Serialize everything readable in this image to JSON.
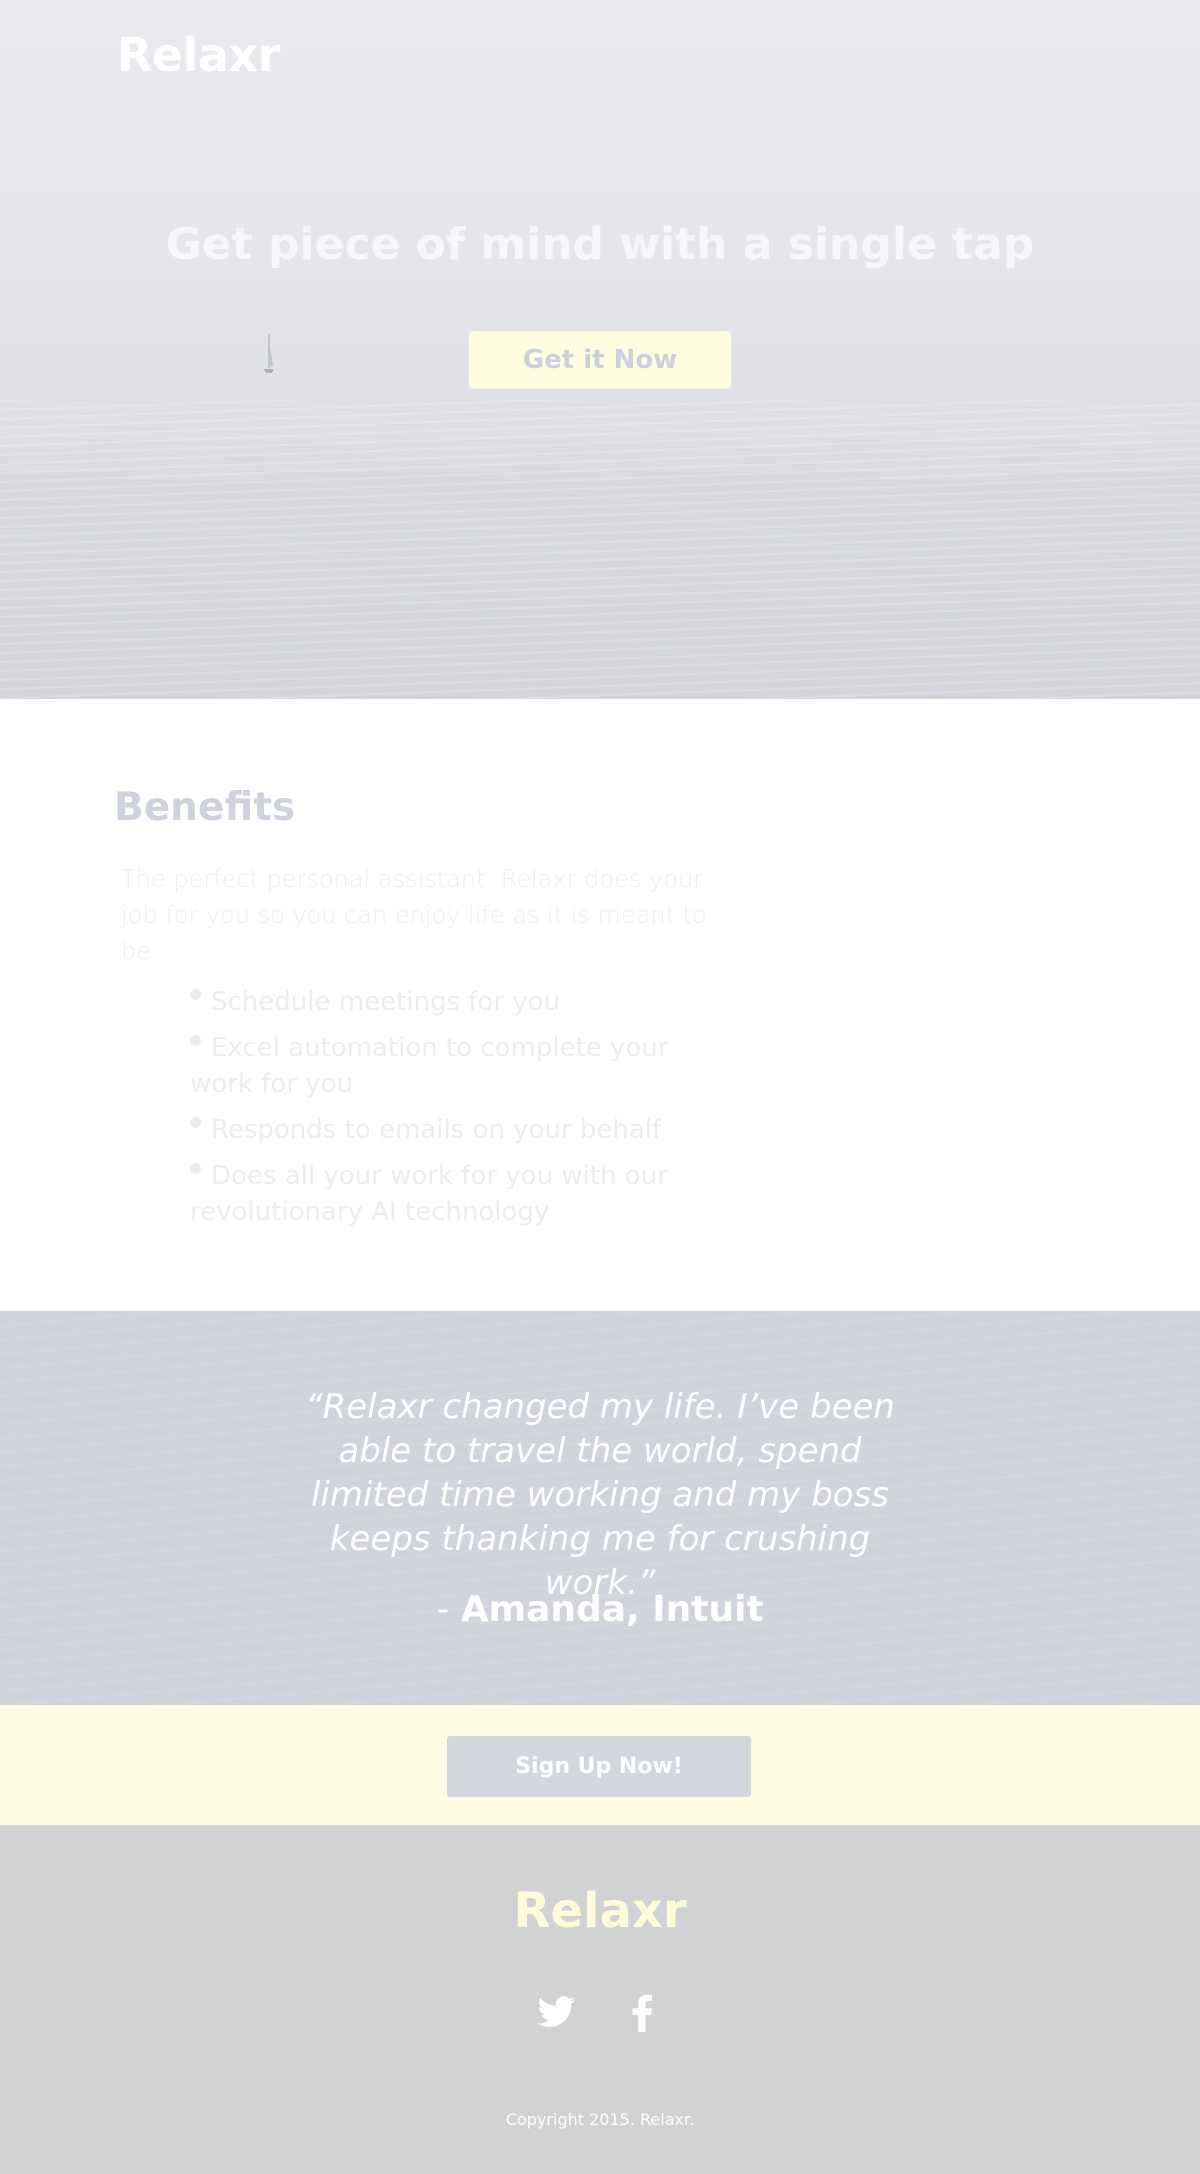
{
  "header": {
    "logo": "Relaxr"
  },
  "hero": {
    "title": "Get piece of mind with a single tap",
    "cta_label": "Get it Now"
  },
  "benefits": {
    "heading": "Benefits",
    "intro": "The perfect personal assistant. Relaxr does your job for you so you can enjoy life as it is meant to be.",
    "items": [
      {
        "label": "Schedule meetings for you"
      },
      {
        "label": "Excel automation to complete your work for you"
      },
      {
        "label": "Responds to emails on your behalf"
      },
      {
        "label": "Does all your work for you with our revolutionary AI technology"
      }
    ]
  },
  "testimonial": {
    "quote": "“Relaxr changed my life. I’ve been able to travel the world, spend limited time working and my boss keeps thanking me for crushing work.”",
    "dash": "- ",
    "author": "Amanda, Intuit"
  },
  "signup": {
    "button_label": "Sign Up Now!"
  },
  "footer": {
    "logo": "Relaxr",
    "social": [
      {
        "icon": "twitter-icon"
      },
      {
        "icon": "facebook-icon"
      }
    ],
    "copyright": "Copyright 2015. Relaxr."
  },
  "colors": {
    "accent_yellow": "#fefde0",
    "heading_blue": "#cfd2de",
    "footer_bg": "#d1d2d3",
    "testimonial_bg": "#d1d3dc"
  }
}
